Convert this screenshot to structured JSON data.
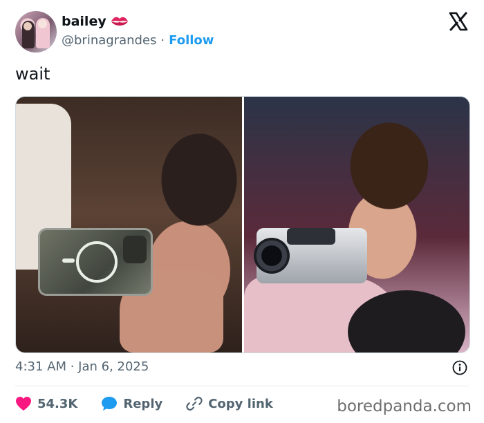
{
  "post": {
    "display_name": "bailey",
    "name_emoji": "kiss-mark-icon",
    "handle": "@brinagrandes",
    "separator": "·",
    "follow_label": "Follow",
    "text": "wait",
    "timestamp": "4:31 AM · Jan 6, 2025"
  },
  "actions": {
    "likes_count": "54.3K",
    "reply_label": "Reply",
    "copy_link_label": "Copy link"
  },
  "watermark": "boredpanda.com",
  "colors": {
    "accent_blue": "#1d9bf0",
    "like_pink": "#f91880",
    "muted_text": "#536471",
    "text": "#0f1419"
  },
  "icons": [
    "kiss-mark-icon",
    "x-logo-icon",
    "info-icon",
    "heart-icon",
    "reply-icon",
    "link-icon"
  ]
}
